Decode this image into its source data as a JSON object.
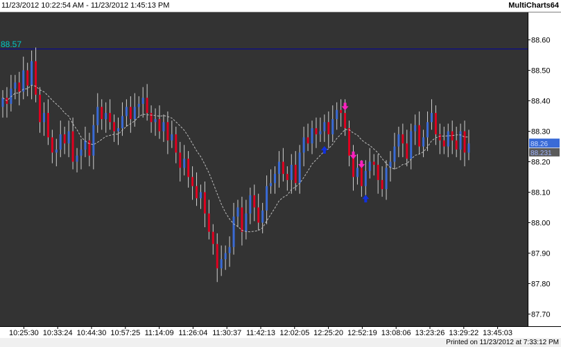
{
  "titlebar": {
    "range": "11/23/2012 10:22:54 AM - 11/23/2012 1:45:13 PM",
    "app": "MultiCharts64"
  },
  "footer": {
    "printed": "Printed on 11/23/2012 at 7:33:12 PM"
  },
  "colors": {
    "background": "#333333",
    "up_bar": "#3a6bd6",
    "down_bar": "#e00020",
    "wick": "#d0d0d0",
    "moving_average": "#bdbdbd",
    "level_line": "#0000a0",
    "level_label": "#00c8c8",
    "buy_arrow": "#1030e0",
    "sell_arrow": "#ff20c0"
  },
  "chart_data": {
    "type": "ohlc",
    "price_axis": {
      "range": [
        87.66,
        88.69
      ],
      "ticks": [
        "88.60",
        "88.50",
        "88.40",
        "88.30",
        "88.20",
        "88.10",
        "88.00",
        "87.90",
        "87.80",
        "87.70"
      ]
    },
    "time_axis": {
      "ticks": [
        "10:25:30",
        "10:33:24",
        "10:44:30",
        "10:57:25",
        "11:14:09",
        "11:26:04",
        "11:30:37",
        "11:42:13",
        "12:02:05",
        "12:25:20",
        "12:52:19",
        "13:08:06",
        "13:23:26",
        "13:29:22",
        "13:45:03"
      ]
    },
    "level_line": {
      "value": 88.57,
      "label": "88.57"
    },
    "last_price_labels": [
      "88.26",
      "88.231"
    ],
    "closes": [
      88.41,
      88.39,
      88.44,
      88.46,
      88.43,
      88.5,
      88.45,
      88.53,
      88.42,
      88.33,
      88.36,
      88.28,
      88.23,
      88.24,
      88.29,
      88.26,
      88.3,
      88.2,
      88.22,
      88.24,
      88.27,
      88.22,
      88.32,
      88.38,
      88.34,
      88.36,
      88.33,
      88.3,
      88.31,
      88.35,
      88.38,
      88.34,
      88.38,
      88.39,
      88.41,
      88.36,
      88.33,
      88.34,
      88.3,
      88.33,
      88.27,
      88.29,
      88.23,
      88.18,
      88.21,
      88.15,
      88.12,
      88.08,
      88.1,
      88.03,
      87.97,
      87.93,
      87.85,
      87.88,
      87.9,
      87.92,
      88.02,
      88.05,
      87.97,
      88.03,
      88.09,
      88.05,
      88.0,
      88.04,
      88.12,
      88.13,
      88.16,
      88.2,
      88.16,
      88.14,
      88.19,
      88.13,
      88.23,
      88.28,
      88.26,
      88.31,
      88.29,
      88.3,
      88.33,
      88.29,
      88.34,
      88.37,
      88.36,
      88.31,
      88.22,
      88.15,
      88.18,
      88.12,
      88.17,
      88.2,
      88.19,
      88.14,
      88.11,
      88.18,
      88.2,
      88.25,
      88.29,
      88.26,
      88.21,
      88.3,
      88.32,
      88.25,
      88.28,
      88.33,
      88.36,
      88.29,
      88.27,
      88.25,
      88.3,
      88.27,
      88.24,
      88.3,
      88.23,
      88.26
    ],
    "signals": [
      {
        "type": "buy",
        "bar": 78
      },
      {
        "type": "sell",
        "bar": 83
      },
      {
        "type": "sell",
        "bar": 85
      },
      {
        "type": "sell",
        "bar": 87
      },
      {
        "type": "buy",
        "bar": 88
      }
    ]
  }
}
